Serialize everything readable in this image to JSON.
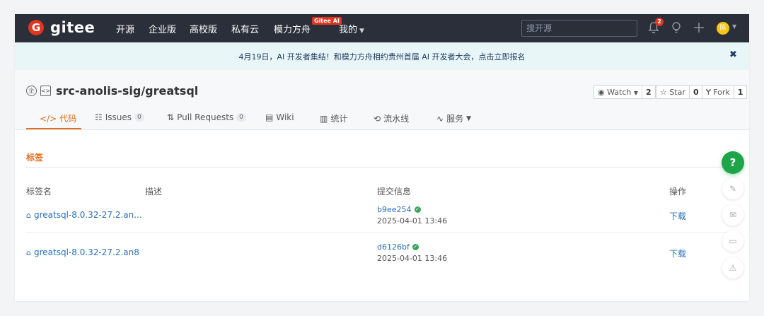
{
  "nav": {
    "logo_letter": "G",
    "logo_text": "gitee",
    "items": [
      {
        "label": "开源"
      },
      {
        "label": "企业版"
      },
      {
        "label": "高校版"
      },
      {
        "label": "私有云"
      },
      {
        "label": "模力方舟"
      },
      {
        "label": "我的"
      }
    ],
    "ai_badge": "Gitee AI",
    "search_placeholder": "搜开源",
    "notification_count": "2",
    "avatar_letter": "陈",
    "bell_icon": "bell-icon",
    "bulb_icon": "lightbulb-icon",
    "plus_icon": "plus-icon"
  },
  "banner": {
    "text": "4月19日，AI 开发者集结！和模力方舟相约贵州首届 AI 开发者大会，点击立即报名",
    "close_glyph": "✖"
  },
  "repo": {
    "name": "src-anolis-sig/greatsql",
    "watch": {
      "label": "Watch",
      "count": "2"
    },
    "star": {
      "label": "Star",
      "count": "0"
    },
    "fork": {
      "label": "Fork",
      "count": "1"
    }
  },
  "tabs": [
    {
      "label": "代码",
      "icon": "code-icon"
    },
    {
      "label": "Issues",
      "count": "0",
      "icon": "issues-icon"
    },
    {
      "label": "Pull Requests",
      "count": "0",
      "icon": "pull-request-icon"
    },
    {
      "label": "Wiki",
      "icon": "wiki-icon"
    },
    {
      "label": "统计",
      "icon": "chart-icon"
    },
    {
      "label": "流水线",
      "icon": "pipeline-icon"
    },
    {
      "label": "服务",
      "icon": "service-icon"
    }
  ],
  "section_title": "标签",
  "table": {
    "headers": [
      "标签名",
      "描述",
      "提交信息",
      "操作"
    ],
    "rows": [
      {
        "tag": "greatsql-8.0.32-27.2.an...",
        "commit": "b9ee254",
        "date": "2025-04-01 13:46",
        "action": "下载"
      },
      {
        "tag": "greatsql-8.0.32-27.2.an8",
        "commit": "d6126bf",
        "date": "2025-04-01 13:46",
        "action": "下载"
      }
    ]
  },
  "floating": {
    "help_glyph": "?"
  },
  "colors": {
    "nav_bg": "#2a2f3a",
    "accent": "#e36e1e",
    "link": "#2a6fb7",
    "brand_red": "#e2351f",
    "banner_bg": "#e8f6f8",
    "help_green": "#1ea54a"
  }
}
